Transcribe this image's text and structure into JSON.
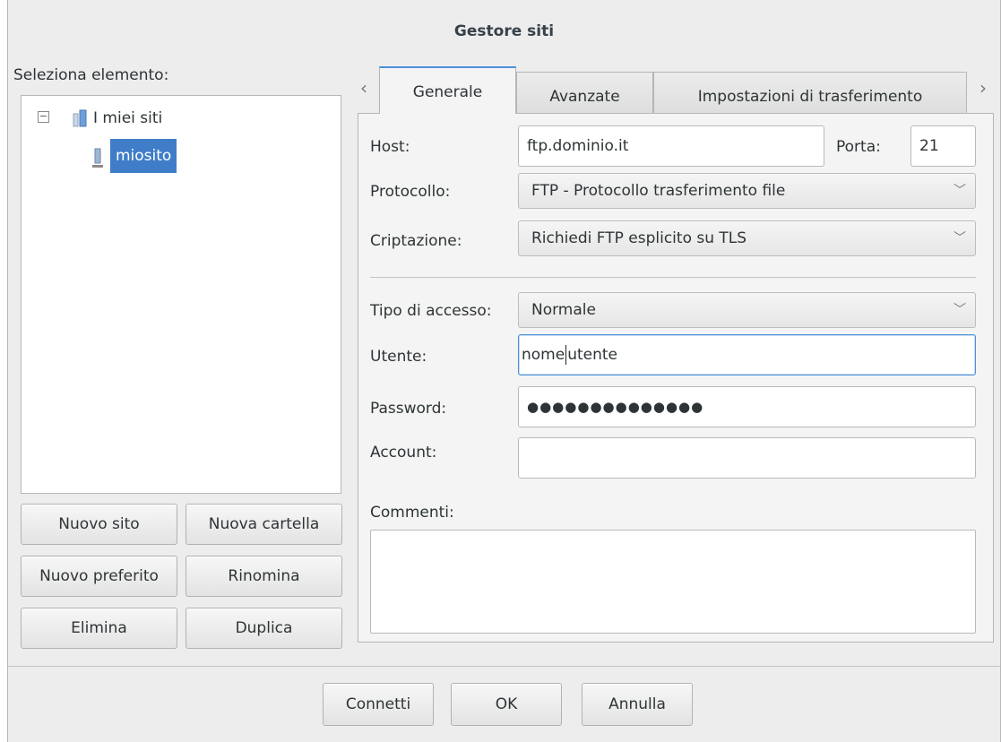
{
  "window": {
    "title": "Gestore siti"
  },
  "left": {
    "select_label": "Seleziona elemento:",
    "tree": {
      "folder": "I miei siti",
      "site": "miosito",
      "toggle": "−"
    },
    "buttons": {
      "new_site": "Nuovo sito",
      "new_folder": "Nuova cartella",
      "new_bookmark": "Nuovo preferito",
      "rename": "Rinomina",
      "delete": "Elimina",
      "duplicate": "Duplica"
    }
  },
  "tabs": {
    "left_arrow": "‹",
    "right_arrow": "›",
    "items": [
      "Generale",
      "Avanzate",
      "Impostazioni di trasferimento"
    ]
  },
  "general": {
    "host_label": "Host:",
    "host_value": "ftp.dominio.it",
    "port_label": "Porta:",
    "port_value": "21",
    "protocol_label": "Protocollo:",
    "protocol_value": "FTP - Protocollo trasferimento file",
    "encryption_label": "Criptazione:",
    "encryption_value": "Richiedi FTP esplicito su TLS",
    "logon_label": "Tipo di accesso:",
    "logon_value": "Normale",
    "user_label": "Utente:",
    "user_value_before_caret": "nome",
    "user_value_after_caret": "utente",
    "password_label": "Password:",
    "password_value": "●●●●●●●●●●●●●●",
    "account_label": "Account:",
    "account_value": "",
    "comments_label": "Commenti:",
    "comments_value": ""
  },
  "footer": {
    "connect": "Connetti",
    "ok": "OK",
    "cancel": "Annulla"
  },
  "icons": {
    "dropdown": "chevron-down-icon",
    "folder": "folder-icon",
    "site": "server-icon"
  }
}
